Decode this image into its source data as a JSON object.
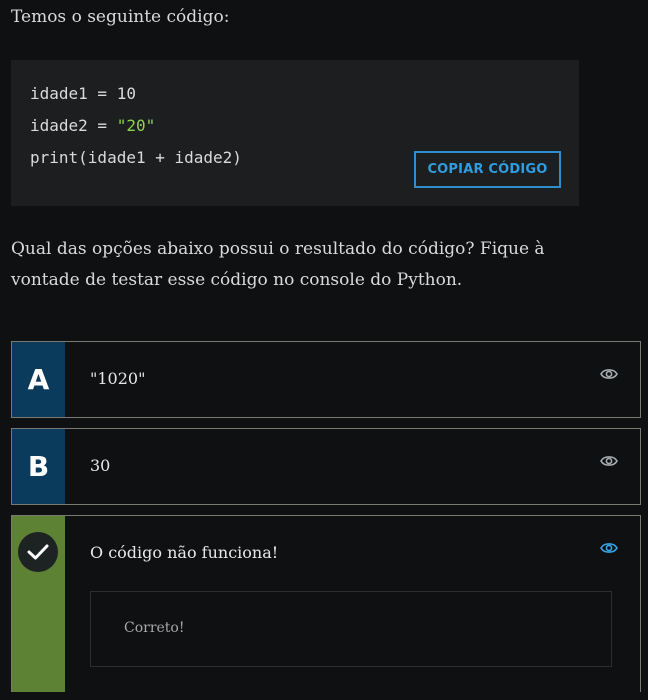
{
  "intro": "Temos o seguinte código:",
  "code": {
    "line1": "idade1 = 10",
    "line2_prefix": "idade2 = ",
    "line2_string": "\"20\"",
    "line3": "print(idade1 + idade2)",
    "copy_label": "COPIAR CÓDIGO"
  },
  "question": "Qual das opções abaixo possui o resultado do código? Fique à vontade de testar esse código no console do Python.",
  "options": [
    {
      "letter": "A",
      "text": "\"1020\"",
      "icon": "eye-icon"
    },
    {
      "letter": "B",
      "text": "30",
      "icon": "eye-icon"
    },
    {
      "text": "O código não funciona!",
      "icon": "eye-icon",
      "status": "check-icon",
      "feedback": "Correto!"
    }
  ],
  "colors": {
    "background": "#0e1011",
    "letter_box": "#0a3a5c",
    "correct_box": "#5d8234",
    "accent_blue": "#2f9de0",
    "string_green": "#8fd14f"
  }
}
